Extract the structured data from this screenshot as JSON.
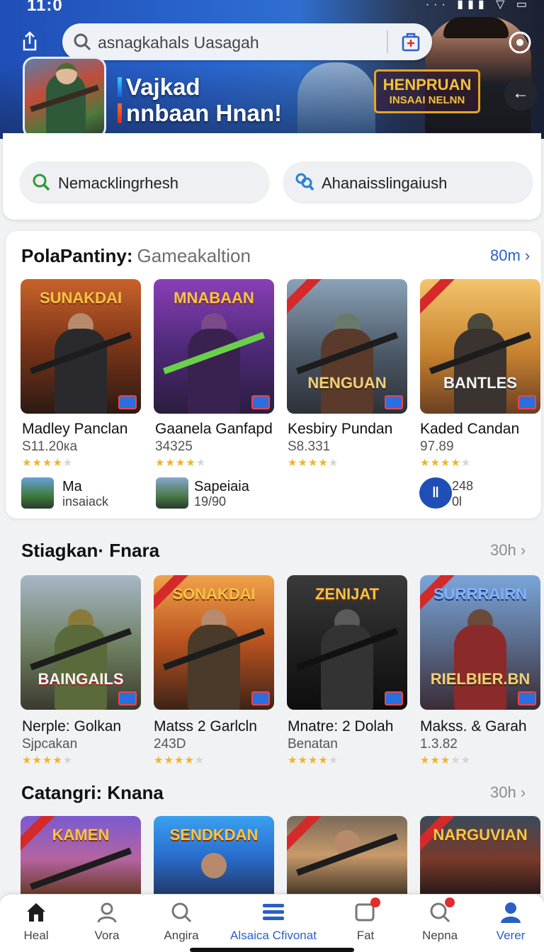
{
  "status_bar": {
    "time": "11:0",
    "right_icons": "··· ▮▮▮ ▽ ▭"
  },
  "search": {
    "placeholder": "asnagkahals Uasagah"
  },
  "hero": {
    "title_line1": "Vajkad",
    "title_line2": "nnbaan Hnan!",
    "logo_line1": "HENPRUAN",
    "logo_line2": "INSAAI NELNN"
  },
  "filters": [
    {
      "label": "Nemacklingrhesh",
      "icon": "search-icon"
    },
    {
      "label": "Ahanaisslingaiush",
      "icon": "binoculars-icon"
    }
  ],
  "section1": {
    "title": "PolaPantiny:",
    "subtitle": "Gameakaltion",
    "more": "80m",
    "games": [
      {
        "name": "Madley Panclan",
        "sub": "S11.20ка",
        "rating": 4,
        "logo": "SUNAKDAI"
      },
      {
        "name": "Gaanela Ganfapd",
        "sub": "34325",
        "rating": 4,
        "logo": "MNABAAN"
      },
      {
        "name": "Kesbiry Pundan",
        "sub": "S8.331",
        "rating": 4,
        "logo": "NENGUAN"
      },
      {
        "name": "Kaded Candan",
        "sub": "97.89",
        "rating": 4,
        "logo": "BANTLES"
      }
    ],
    "extras": [
      {
        "title": "Ma",
        "sub": "insaiack"
      },
      {
        "title": "Sapeiaia",
        "sub": "19/90"
      },
      {
        "title": "248",
        "sub": "0l"
      }
    ]
  },
  "section2": {
    "title": "Stiagkan· Fnara",
    "more": "30h",
    "games": [
      {
        "name": "Nerple: Golkan",
        "sub": "Sjpcakan",
        "rating": 4,
        "logo": "BAINGAILS"
      },
      {
        "name": "Matss 2 Garlcln",
        "sub": "243D",
        "rating": 4,
        "logo": "SONAKDAI"
      },
      {
        "name": "Mnatre: 2 Dolah",
        "sub": "Benatan",
        "rating": 4,
        "logo": "ZENIJAT"
      },
      {
        "name": "Makss. & Garah",
        "sub": "1.3.82",
        "rating": 3,
        "logo": "RIELBIER.BN"
      }
    ]
  },
  "section3": {
    "title": "Catangri: Knana",
    "more": "30h",
    "logos": [
      "KAMEN",
      "SENDKDAN",
      "",
      "NARGUVIAN"
    ]
  },
  "nav": [
    {
      "label": "Heal",
      "icon": "home-icon"
    },
    {
      "label": "Vora",
      "icon": "profile-icon"
    },
    {
      "label": "Angira",
      "icon": "search-icon"
    },
    {
      "label": "Alsaica Cfivonat",
      "icon": "list-icon",
      "active": true
    },
    {
      "label": "Fat",
      "icon": "chat-icon"
    },
    {
      "label": "Nepna",
      "icon": "search-alert-icon"
    },
    {
      "label": "Verer",
      "icon": "account-icon",
      "active": true
    }
  ],
  "colors": {
    "accent": "#2a5fc9",
    "star": "#f0b429",
    "badge_red": "#e12d2d"
  }
}
